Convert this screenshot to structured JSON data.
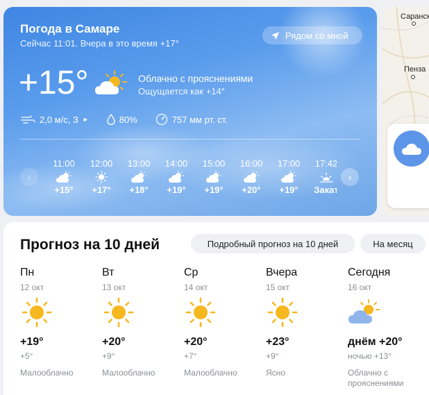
{
  "colors": {
    "hero_top": "#3f86e3",
    "sun": "#f6b81f",
    "cloud": "#8fb5ea",
    "muted": "#8a8f96"
  },
  "current": {
    "title": "Погода в Самаре",
    "subtitle": "Сейчас 11:01. Вчера в это время +17°",
    "nearby_label": "Рядом со мной",
    "temperature": "+15°",
    "condition": "Облачно с прояснениями",
    "feels_like": "Ощущается как +14°",
    "condition_icon": "partly-cloudy-icon",
    "wind": "2,0 м/с, З",
    "humidity": "80%",
    "pressure": "757 мм рт. ст."
  },
  "hourly": [
    {
      "time": "11:00",
      "temp": "+15°",
      "icon": "partly-cloudy"
    },
    {
      "time": "12:00",
      "temp": "+17°",
      "icon": "sun"
    },
    {
      "time": "13:00",
      "temp": "+18°",
      "icon": "partly-cloudy"
    },
    {
      "time": "14:00",
      "temp": "+19°",
      "icon": "partly-cloudy"
    },
    {
      "time": "15:00",
      "temp": "+19°",
      "icon": "partly-cloudy"
    },
    {
      "time": "16:00",
      "temp": "+20°",
      "icon": "partly-cloudy"
    },
    {
      "time": "17:00",
      "temp": "+19°",
      "icon": "partly-cloudy"
    },
    {
      "time": "17:42",
      "temp": "Закат",
      "icon": "sunset"
    }
  ],
  "map": {
    "cities": [
      "Саранск",
      "Пенза"
    ]
  },
  "forecast": {
    "title": "Прогноз на 10 дней",
    "detailed_label": "Подробный прогноз на 10 дней",
    "month_label": "На месяц",
    "days": [
      {
        "name": "Пн",
        "date": "12 окт",
        "high": "+19°",
        "low": "+5°",
        "condition": "Малооблачно",
        "icon": "sun"
      },
      {
        "name": "Вт",
        "date": "13 окт",
        "high": "+20°",
        "low": "+9°",
        "condition": "Малооблачно",
        "icon": "sun"
      },
      {
        "name": "Ср",
        "date": "14 окт",
        "high": "+20°",
        "low": "+7°",
        "condition": "Малооблачно",
        "icon": "sun"
      },
      {
        "name": "Вчера",
        "date": "15 окт",
        "high": "+23°",
        "low": "+9°",
        "condition": "Ясно",
        "icon": "sun"
      },
      {
        "name": "Сегодня",
        "date": "16 окт",
        "high": "днём +20°",
        "low": "ночью +13°",
        "condition": "Облачно с прояснениями",
        "icon": "partly-cloudy"
      }
    ]
  }
}
